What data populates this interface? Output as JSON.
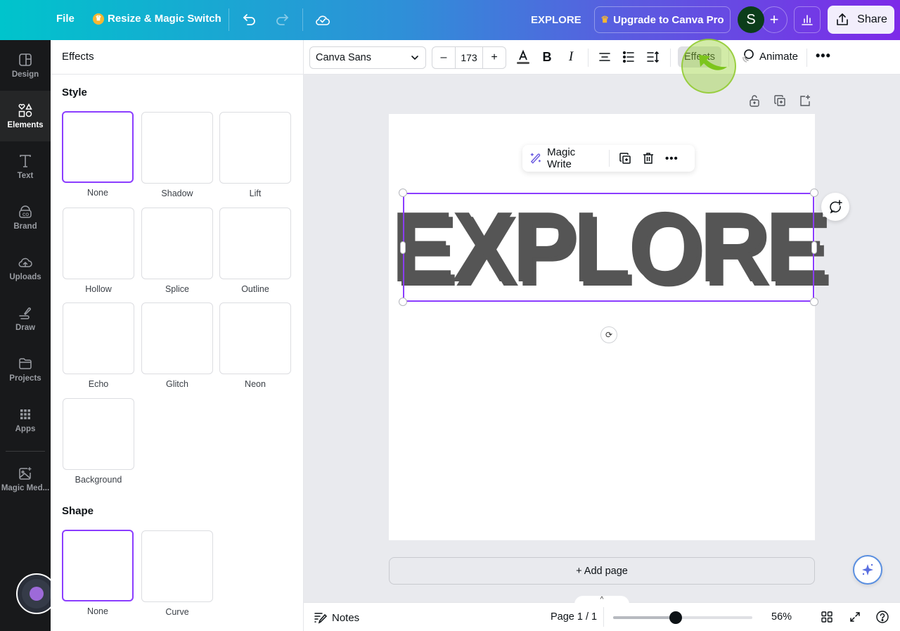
{
  "topbar": {
    "file_label": "File",
    "resize_label": "Resize & Magic Switch",
    "design_title": "EXPLORE",
    "upgrade_label": "Upgrade to Canva Pro",
    "avatar_initial": "S",
    "share_label": "Share",
    "gradient_start": "#00c4cc",
    "gradient_end": "#7d2ae8"
  },
  "sidebar": {
    "items": [
      {
        "label": "Design",
        "icon": "layout-icon"
      },
      {
        "label": "Elements",
        "icon": "shapes-icon",
        "active": true
      },
      {
        "label": "Text",
        "icon": "text-icon"
      },
      {
        "label": "Brand",
        "icon": "brand-icon"
      },
      {
        "label": "Uploads",
        "icon": "cloud-upload-icon"
      },
      {
        "label": "Draw",
        "icon": "pen-icon"
      },
      {
        "label": "Projects",
        "icon": "folder-icon"
      },
      {
        "label": "Apps",
        "icon": "grid-icon"
      },
      {
        "label": "Magic Med...",
        "icon": "magic-media-icon"
      }
    ]
  },
  "effects_panel": {
    "title": "Effects",
    "style_title": "Style",
    "style_options": [
      "None",
      "Shadow",
      "Lift",
      "Hollow",
      "Splice",
      "Outline",
      "Echo",
      "Glitch",
      "Neon",
      "Background"
    ],
    "style_selected": "None",
    "shape_title": "Shape",
    "shape_options": [
      "None",
      "Curve"
    ],
    "shape_selected": "None",
    "accent_color": "#8b3dff"
  },
  "context_toolbar": {
    "font_name": "Canva Sans",
    "font_size": "173",
    "decrease_label": "–",
    "increase_label": "+",
    "effects_label": "Effects",
    "animate_label": "Animate",
    "more_label": "•••"
  },
  "canvas": {
    "magic_write_label": "Magic Write",
    "text_content": "EXPLORE",
    "text_color": "#555555",
    "add_page_label": "+ Add page"
  },
  "footer": {
    "notes_label": "Notes",
    "page_indicator": "Page 1 / 1",
    "zoom_percent": 56,
    "zoom_label": "56%",
    "zoom_slider_fraction": 0.45
  }
}
